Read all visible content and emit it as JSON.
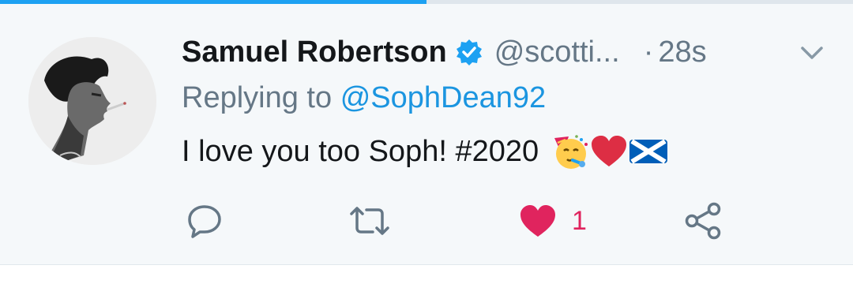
{
  "progress": {
    "value": 0.5
  },
  "tweet": {
    "author_name": "Samuel Robertson",
    "handle": "@scotti...",
    "separator": "·",
    "timestamp": "28s",
    "reply_prefix": "Replying to",
    "reply_handle": "@SophDean92",
    "text": "I love you too Soph! #2020",
    "emojis": [
      "partying-face-icon",
      "red-heart-icon",
      "scotland-flag-icon"
    ]
  },
  "actions": {
    "reply_icon": "reply-icon",
    "retweet_icon": "retweet-icon",
    "like_icon": "heart-icon",
    "like_count": "1",
    "share_icon": "share-icon"
  },
  "colors": {
    "accent": "#1da1f2",
    "link": "#1b95e0",
    "like": "#e0245e",
    "secondary_text": "#657786",
    "primary_text": "#14171a",
    "background": "#f5f8fa"
  }
}
